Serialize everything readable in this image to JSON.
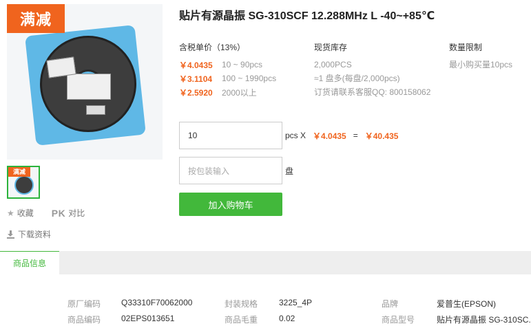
{
  "product": {
    "title": "贴片有源晶振 SG-310SCF 12.288MHz L -40~+85℃",
    "promo_badge": "满减",
    "thumb_badge": "满减"
  },
  "actions": {
    "favorite": "收藏",
    "compare_prefix": "PK",
    "compare": "对比",
    "download": "下载资料"
  },
  "pricing": {
    "header": "含税单价（13%）",
    "tiers": [
      {
        "price": "￥4.0435",
        "qty": "10 ~ 90pcs"
      },
      {
        "price": "￥3.1104",
        "qty": "100 ~ 1990pcs"
      },
      {
        "price": "￥2.5920",
        "qty": "2000以上"
      }
    ]
  },
  "stock": {
    "header": "现货库存",
    "lines": [
      "2,000PCS",
      "≈1 盘多(每盘/2,000pcs)",
      "订货请联系客服QQ: 800158062"
    ]
  },
  "limit": {
    "header": "数量限制",
    "text": "最小购买量10pcs"
  },
  "order": {
    "quantity": "10",
    "unit": "pcs X",
    "unit_price": "￥4.0435",
    "equals": "=",
    "total": "￥40.435",
    "pack_placeholder": "按包装输入",
    "pack_unit": "盘",
    "cart_button": "加入购物车"
  },
  "tabs": {
    "active": "商品信息"
  },
  "specs": {
    "row1": [
      {
        "label": "原厂编码",
        "value": "Q33310F70062000"
      },
      {
        "label": "封装规格",
        "value": "3225_4P"
      },
      {
        "label": "品牌",
        "value": "爱普生(EPSON)"
      }
    ],
    "row2": [
      {
        "label": "商品编码",
        "value": "02EPS013651"
      },
      {
        "label": "商品毛重",
        "value": "0.02"
      },
      {
        "label": "商品型号",
        "value": "贴片有源晶振 SG-310SC..."
      }
    ]
  },
  "colors": {
    "accent_orange": "#f0641e",
    "accent_green": "#42b83b"
  }
}
